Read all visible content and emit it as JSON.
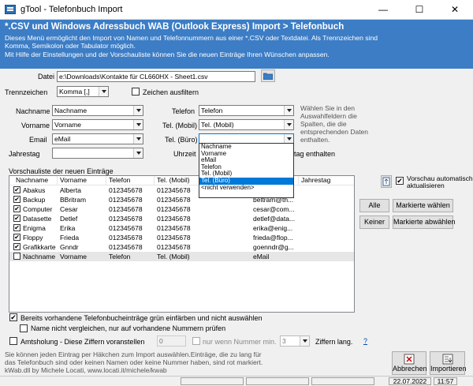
{
  "window": {
    "title": "gTool - Telefonbuch Import",
    "minimize": "—",
    "maximize": "☐",
    "close": "✕"
  },
  "banner": {
    "title": "*.CSV und Windows Adressbuch WAB (Outlook Express) Import > Telefonbuch",
    "desc1": "Dieses Menü ermöglicht den Import von Namen und Telefonnummern aus einer *.CSV oder Textdatei. Als Trennzeichen sind",
    "desc2": "Komma, Semikolon oder Tabulator möglich.",
    "desc3": "Mit Hilfe der Einstellungen und der Vorschauliste können Sie die neuen Einträge Ihren Wünschen anpassen."
  },
  "file": {
    "label": "Datei",
    "value": "e:\\Downloads\\Kontakte für CL660HX - Sheet1.csv"
  },
  "separator": {
    "label": "Trennzeichen",
    "value": "Komma [,]"
  },
  "trim": {
    "label": "Zeichen ausfiltern",
    "checked": false
  },
  "mapping": {
    "nachname": {
      "label": "Nachname",
      "value": "Nachname"
    },
    "vorname": {
      "label": "Vorname",
      "value": "Vorname"
    },
    "email": {
      "label": "Email",
      "value": "eMail"
    },
    "jahrestag": {
      "label": "Jahrestag",
      "value": ""
    },
    "telefon": {
      "label": "Telefon",
      "value": "Telefon"
    },
    "mobil": {
      "label": "Tel. (Mobil)",
      "value": "Tel. (Mobil)"
    },
    "buero": {
      "label": "Tel. (Büro)",
      "value": ""
    },
    "uhrzeit": {
      "label": "Uhrzeit"
    }
  },
  "hint": [
    "Wählen Sie in den",
    "Auswahlfeldern die",
    "Spalten, die die",
    "entsprechenden Daten",
    "enthalten."
  ],
  "hint2": "tag enthalten",
  "dropdown": [
    "Nachname",
    "Vorname",
    "eMail",
    "Telefon",
    "Tel. (Mobil)",
    "Tel. (Büro)",
    "<nicht verwenden>"
  ],
  "preview": {
    "label": "Vorschauliste der neuen Einträge",
    "headers": [
      "Nachname",
      "Vorname",
      "Telefon",
      "Tel. (Mobil)",
      "",
      "Jahrestag"
    ],
    "rows": [
      {
        "checked": "✔",
        "nachname": "Abakus",
        "vorname": "Alberta",
        "telefon": "012345678",
        "mobil": "012345678",
        "email": ""
      },
      {
        "checked": "✔",
        "nachname": "Backup",
        "vorname": "BBritram",
        "telefon": "012345678",
        "mobil": "012345678",
        "email": "beltram@th..."
      },
      {
        "checked": "✔",
        "nachname": "Computer",
        "vorname": "Cesar",
        "telefon": "012345678",
        "mobil": "012345678",
        "email": "cesar@com..."
      },
      {
        "checked": "✔",
        "nachname": "Datasette",
        "vorname": "Detlef",
        "telefon": "012345678",
        "mobil": "012345678",
        "email": "detlef@data..."
      },
      {
        "checked": "✔",
        "nachname": "Enigma",
        "vorname": "Erika",
        "telefon": "012345678",
        "mobil": "012345678",
        "email": "erika@enig..."
      },
      {
        "checked": "✔",
        "nachname": "Floppy",
        "vorname": "Frieda",
        "telefon": "012345678",
        "mobil": "012345678",
        "email": "frieda@flop..."
      },
      {
        "checked": "✔",
        "nachname": "Grafikkarte",
        "vorname": "Gnndr",
        "telefon": "012345678",
        "mobil": "012345678",
        "email": "goenndr@g..."
      },
      {
        "checked": "",
        "nachname": "Nachname",
        "vorname": "Vorname",
        "telefon": "Telefon",
        "mobil": "Tel. (Mobil)",
        "email": "eMail"
      }
    ]
  },
  "auto_preview": {
    "label1": "Vorschau automatisch",
    "label2": "aktualisieren",
    "checked": true
  },
  "buttons": {
    "alle": "Alle",
    "markierte_waehlen": "Markierte wählen",
    "keiner": "Keiner",
    "markierte_abwaehlen": "Markierte abwählen",
    "abbrechen": "Abbrechen",
    "importieren": "Importieren"
  },
  "options": {
    "gruen": {
      "label": "Bereits vorhandene Telefonbucheinträge grün einfärben und nicht auswählen",
      "checked": true
    },
    "name_compare": {
      "label": "Name nicht vergleichen, nur auf vorhandene Nummern prüfen",
      "checked": false
    },
    "amtsholung": {
      "label": "Amtsholung - Diese Ziffern voranstellen",
      "checked": false,
      "value": "0"
    },
    "nur_wenn": {
      "label": "nur wenn Nummer min.",
      "value": "3",
      "suffix": "Ziffern lang.",
      "help": "?"
    }
  },
  "footer": [
    "Sie können jeden Eintrag per Häkchen zum Import auswählen.Einträge, die zu lang für",
    "das Telefonbuch sind oder keinen Namen oder keine Nummer haben, sind rot markiert.",
    "kWab.dll by Michele Locati, www.locati.it/michele/kwab"
  ],
  "status": {
    "date": "22.07.2022",
    "time": "11:57"
  }
}
